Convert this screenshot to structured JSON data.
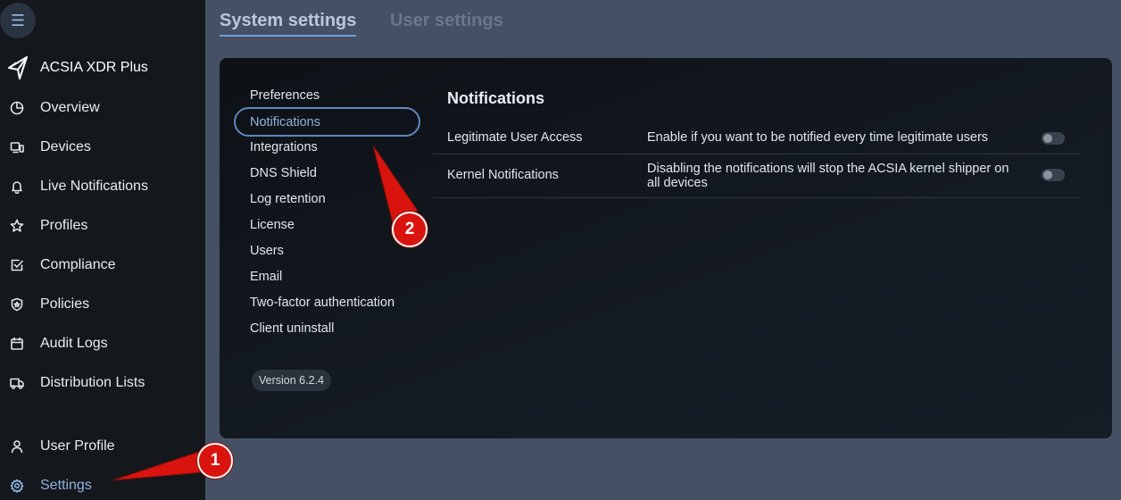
{
  "sidebar": {
    "brand": "ACSIA XDR Plus",
    "items": [
      {
        "label": "Overview"
      },
      {
        "label": "Devices"
      },
      {
        "label": "Live Notifications"
      },
      {
        "label": "Profiles"
      },
      {
        "label": "Compliance"
      },
      {
        "label": "Policies"
      },
      {
        "label": "Audit Logs"
      },
      {
        "label": "Distribution Lists"
      }
    ],
    "bottom_items": [
      {
        "label": "User Profile"
      },
      {
        "label": "Settings"
      }
    ]
  },
  "tabs": {
    "system": "System settings",
    "user": "User settings"
  },
  "submenu": {
    "items": [
      "Preferences",
      "Notifications",
      "Integrations",
      "DNS Shield",
      "Log retention",
      "License",
      "Users",
      "Email",
      "Two-factor authentication",
      "Client uninstall"
    ],
    "active": "Notifications",
    "version": "Version 6.2.4"
  },
  "notifications": {
    "title": "Notifications",
    "rows": [
      {
        "label": "Legitimate User Access",
        "description": "Enable if you want to be notified every time legitimate users",
        "enabled": false
      },
      {
        "label": "Kernel Notifications",
        "description": "Disabling the notifications will stop the ACSIA kernel shipper on all devices",
        "enabled": false
      }
    ]
  },
  "annotations": {
    "badge1": "1",
    "badge2": "2"
  },
  "colors": {
    "accent": "#8fb3e0",
    "annotation": "#d9140e"
  }
}
